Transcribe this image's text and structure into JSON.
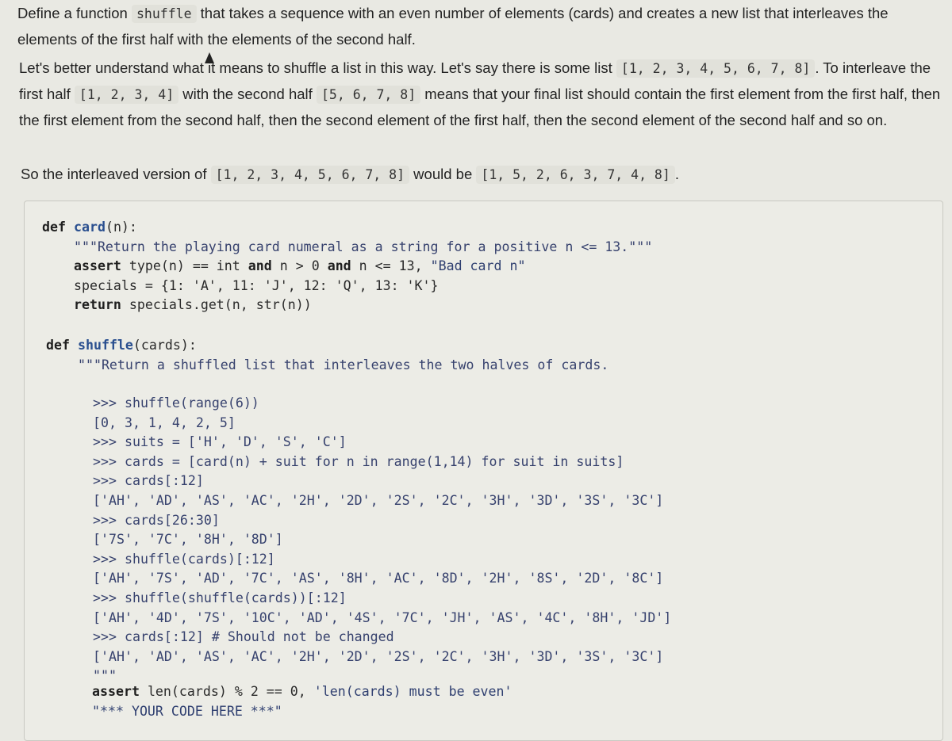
{
  "prose": {
    "p1": {
      "t1": "Define a function ",
      "c1": "shuffle",
      "t2": " that takes a sequence with an even number of elements (cards) and creates a new list that interleaves the elements of the first half with the elements of the second half."
    },
    "p2": {
      "t1": "Let's better understand what it means to shuffle a list in this way. Let's say there is some list ",
      "c1": "[1, 2, 3, 4, 5, 6, 7, 8]",
      "t2": ". To interleave the first half ",
      "c2": "[1, 2, 3, 4]",
      "t3": " with the second half ",
      "c3": "[5, 6, 7, 8]",
      "t4": " means that your final list should contain the first element from the first half, then the first element from the second half, then the second element of the first half, then the second element of the second half and so on."
    },
    "p3": {
      "t1": "So the interleaved version of ",
      "c1": "[1, 2, 3, 4, 5, 6, 7, 8]",
      "t2": " would be ",
      "c2": "[1, 5, 2, 6, 3, 7, 4, 8]",
      "t3": "."
    }
  },
  "code": {
    "card_def": {
      "kw": "def",
      "name": "card",
      "args": "(n):"
    },
    "card_doc": "\"\"\"Return the playing card numeral as a string for a positive n <= 13.\"\"\"",
    "card_assert": {
      "kw1": "assert",
      "a": " type(n) == int ",
      "kw2": "and",
      "b": " n > 0 ",
      "kw3": "and",
      "c": " n <= 13, ",
      "s": "\"Bad card n\""
    },
    "card_specials": "specials = {1: 'A', 11: 'J', 12: 'Q', 13: 'K'}",
    "card_return": {
      "kw": "return",
      "rest": " specials.get(n, str(n))"
    },
    "shuffle_def": {
      "kw": "def",
      "name": "shuffle",
      "args": "(cards):"
    },
    "shuffle_doc": "\"\"\"Return a shuffled list that interleaves the two halves of cards.",
    "doctest": [
      ">>> shuffle(range(6))",
      "[0, 3, 1, 4, 2, 5]",
      ">>> suits = ['H', 'D', 'S', 'C']",
      ">>> cards = [card(n) + suit for n in range(1,14) for suit in suits]",
      ">>> cards[:12]",
      "['AH', 'AD', 'AS', 'AC', '2H', '2D', '2S', '2C', '3H', '3D', '3S', '3C']",
      ">>> cards[26:30]",
      "['7S', '7C', '8H', '8D']",
      ">>> shuffle(cards)[:12]",
      "['AH', '7S', 'AD', '7C', 'AS', '8H', 'AC', '8D', '2H', '8S', '2D', '8C']",
      ">>> shuffle(shuffle(cards))[:12]",
      "['AH', '4D', '7S', '10C', 'AD', '4S', '7C', 'JH', 'AS', '4C', '8H', 'JD']",
      ">>> cards[:12] # Should not be changed",
      "['AH', 'AD', 'AS', 'AC', '2H', '2D', '2S', '2C', '3H', '3D', '3S', '3C']",
      "\"\"\""
    ],
    "final_assert": {
      "kw": "assert",
      "rest": " len(cards) % 2 == 0, ",
      "s": "'len(cards) must be even'"
    },
    "placeholder": "\"*** YOUR CODE HERE ***\""
  }
}
